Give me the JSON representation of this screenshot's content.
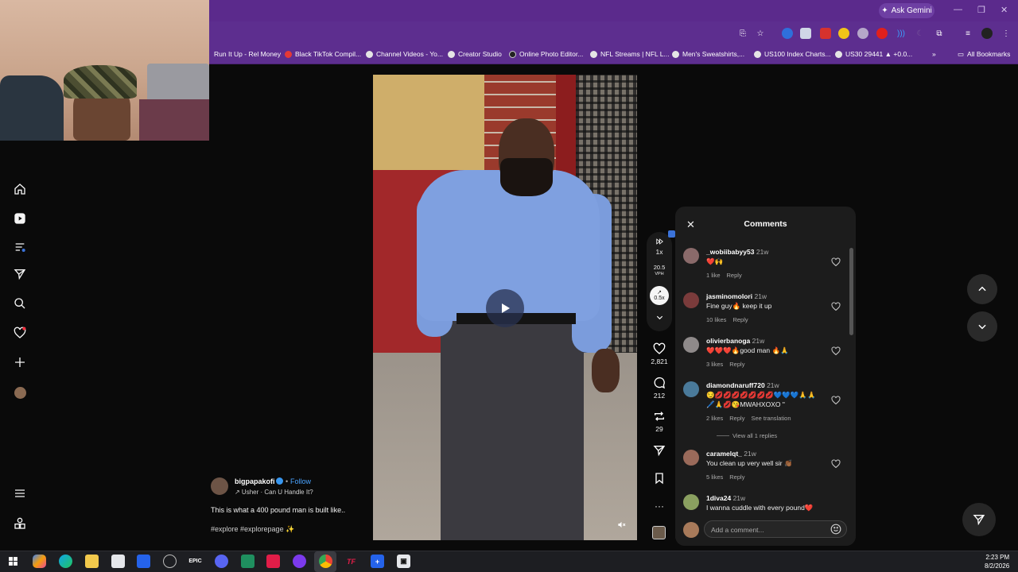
{
  "browser": {
    "ask_gemini": "Ask Gemini",
    "bookmarks": [
      "Run It Up - Rel Money",
      "Black TikTok Compil...",
      "Channel Videos - Yo...",
      "Creator Studio",
      "Online Photo Editor...",
      "NFL Streams | NFL L...",
      "Men's Sweatshirts,...",
      "US100 Index Charts...",
      "US30 29441 ▲ +0.0..."
    ],
    "all_bookmarks": "All Bookmarks",
    "more_bookmarks": "»"
  },
  "post": {
    "username": "bigpapakofi",
    "follow_label": "Follow",
    "song": "↗ Usher · Can U Handle It?",
    "caption": "This is what a 400 pound man is built like..",
    "hashtags": "#explore #explorepage ✨"
  },
  "actions": {
    "speed": "1x",
    "vph_value": "20.5",
    "vph_label": "VPH",
    "trend_value": "0.5x",
    "likes": "2,821",
    "comments": "212",
    "reposts": "29"
  },
  "comments_panel": {
    "title": "Comments",
    "input_placeholder": "Add a comment...",
    "items": [
      {
        "user": "_wobiibabyy53",
        "time": "21w",
        "text": "❤️🙌",
        "likes": "1 like",
        "reply": "Reply",
        "avatar_color": "#8a6a6a"
      },
      {
        "user": "jasminomolori",
        "time": "21w",
        "text": "Fine guy🔥 keep it up",
        "likes": "10 likes",
        "reply": "Reply",
        "avatar_color": "#7a3b3b"
      },
      {
        "user": "olivierbanoga",
        "time": "21w",
        "text": "❤️❤️❤️🔥good man 🔥🙏",
        "likes": "3 likes",
        "reply": "Reply",
        "avatar_color": "#8f8a8a"
      },
      {
        "user": "diamondnaruff720",
        "time": "21w",
        "text": "😏💋💋💋💋💋💋💋💙💙💙🙏🙏",
        "text2": "🖊️🙏💋😘MWAHXOXO \"",
        "likes": "2 likes",
        "reply": "Reply",
        "translate": "See translation",
        "replies": "View all 1 replies",
        "avatar_color": "#4a7a9a"
      },
      {
        "user": "caramelqt_",
        "time": "21w",
        "text": "You clean up very well sir 👏🏾",
        "likes": "5 likes",
        "reply": "Reply",
        "avatar_color": "#9a6a5a"
      },
      {
        "user": "1diva24",
        "time": "21w",
        "text": "I wanna cuddle with every pound❤️",
        "avatar_color": "#8aa060"
      }
    ]
  },
  "taskbar": {
    "time": "2:23 PM",
    "date": "8/2/2026",
    "epic_label": "EPIC",
    "tf_label": "TF"
  }
}
